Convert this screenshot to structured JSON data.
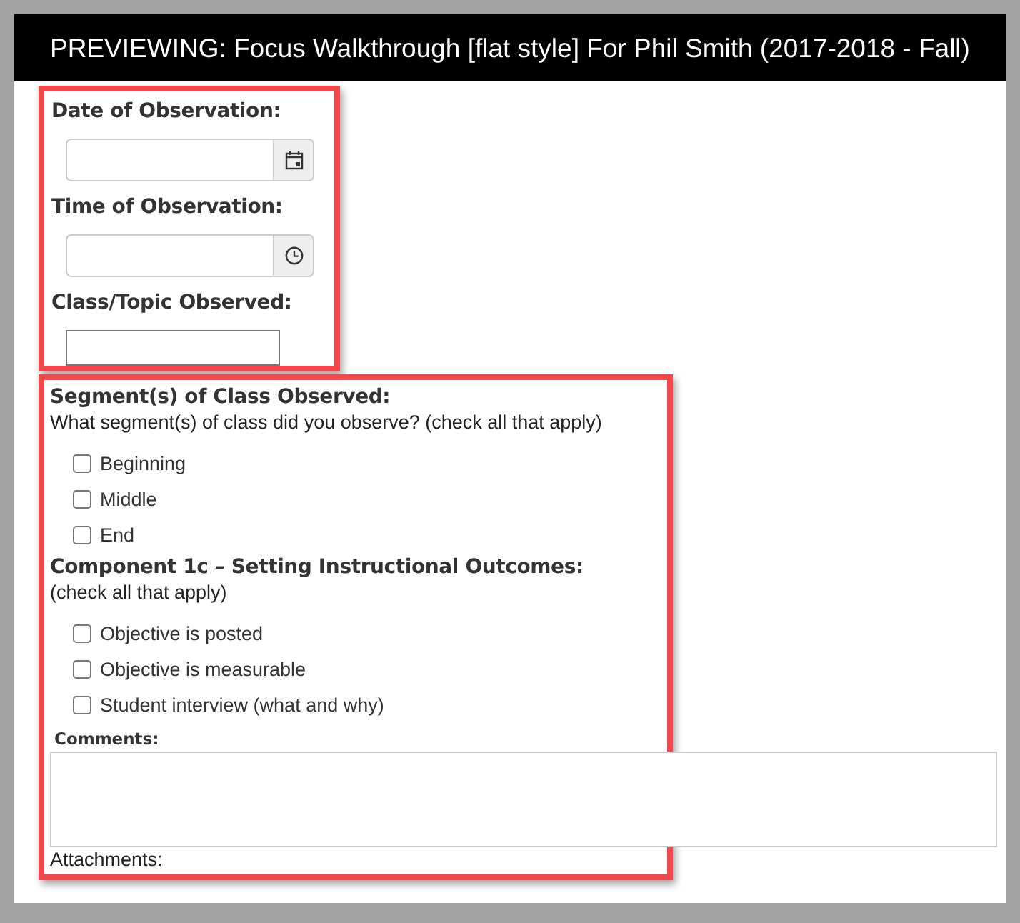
{
  "header": {
    "title": "PREVIEWING: Focus Walkthrough [flat style] For Phil Smith (2017-2018 - Fall)"
  },
  "fields": [
    {
      "label": "Date of Observation:",
      "kind": "date"
    },
    {
      "label": "Time of Observation:",
      "kind": "time"
    },
    {
      "label": "Class/Topic Observed:",
      "kind": "text"
    }
  ],
  "questions": [
    {
      "title": "Segment(s) of Class Observed:",
      "instruction": "What segment(s) of class did you observe? (check all that apply)",
      "options": [
        {
          "label": "Beginning",
          "checked": false
        },
        {
          "label": "Middle",
          "checked": false
        },
        {
          "label": "End",
          "checked": false
        }
      ]
    },
    {
      "title": "Component 1c – Setting Instructional Outcomes:",
      "instruction": "(check all that apply)",
      "options": [
        {
          "label": "Objective is posted",
          "checked": false
        },
        {
          "label": "Objective is measurable",
          "checked": false
        },
        {
          "label": "Student interview (what and why)",
          "checked": false
        }
      ]
    }
  ],
  "comments": {
    "label": "Comments:"
  },
  "attachments": {
    "label": "Attachments:"
  }
}
